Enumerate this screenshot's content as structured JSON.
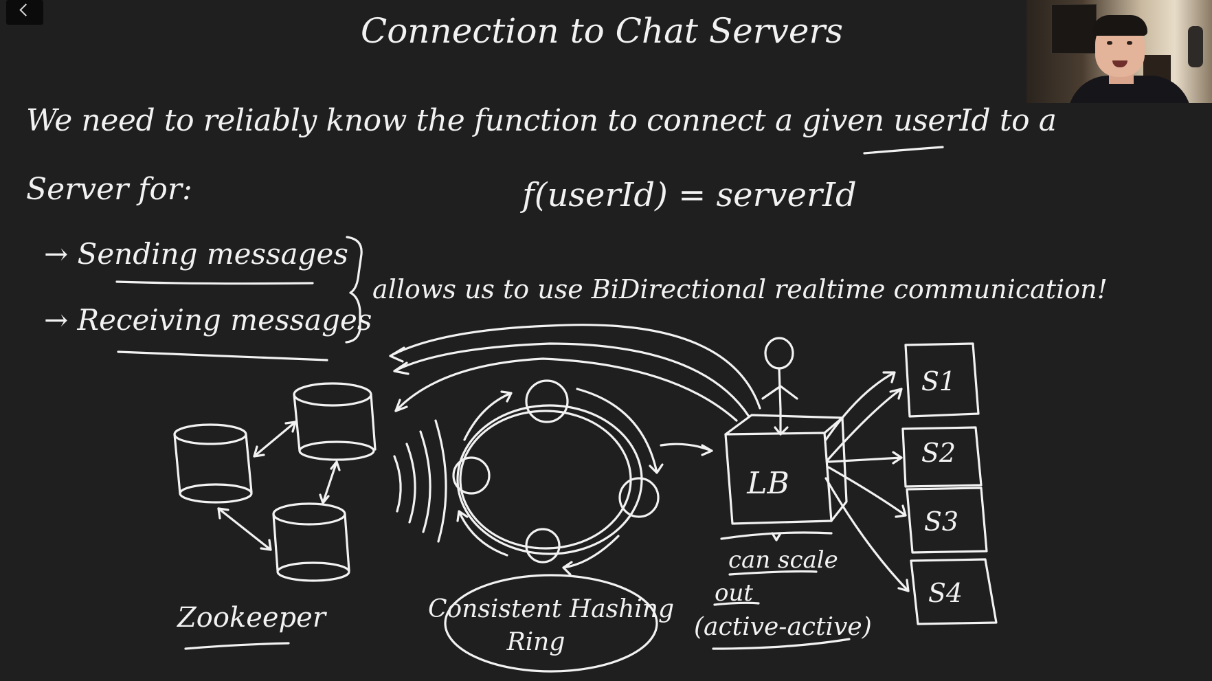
{
  "title": "Connection to Chat Servers",
  "intro_line1": "We need to reliably know the function to connect a given userId to a",
  "intro_line2": "Server for:",
  "formula": "f(userId) = serverId",
  "bullets": [
    "→ Sending messages",
    "→ Receiving messages"
  ],
  "brace_note": "allows us to use BiDirectional realtime communication!",
  "zookeeper_label": "Zookeeper",
  "ring_label_line1": "Consistent Hashing",
  "ring_label_line2": "Ring",
  "lb_label": "LB",
  "scale_line1": "can scale",
  "scale_line2": "out",
  "scale_line3": "(active-active)",
  "servers": [
    "S1",
    "S2",
    "S3",
    "S4"
  ],
  "colors": {
    "background": "#1f1f1f",
    "ink": "#f2f2f2"
  },
  "icons": {
    "back": "chevron-left-icon",
    "webcam": "presenter-webcam"
  }
}
